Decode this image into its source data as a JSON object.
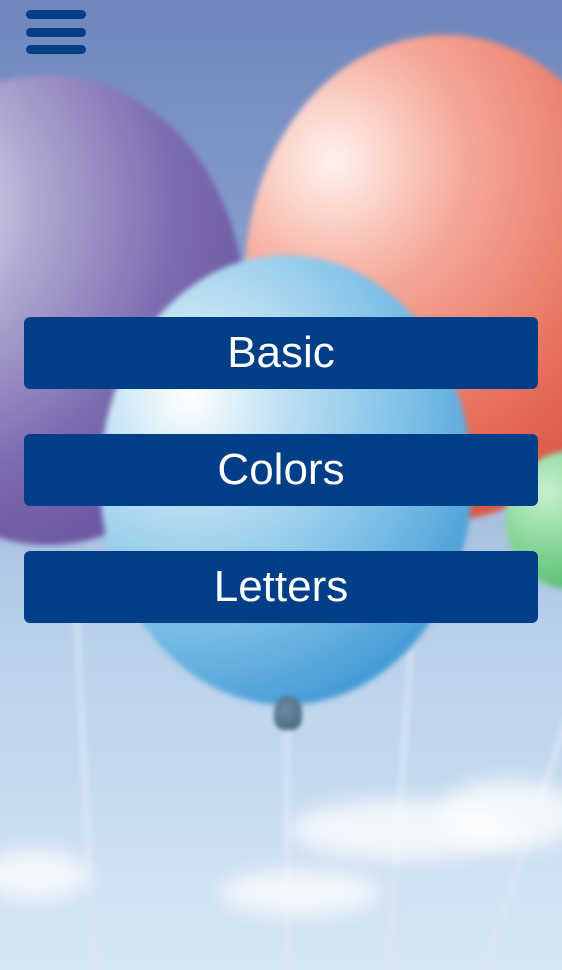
{
  "header": {
    "menu_icon": "hamburger-menu-icon"
  },
  "menu": {
    "items": [
      {
        "label": "Basic"
      },
      {
        "label": "Colors"
      },
      {
        "label": "Letters"
      }
    ]
  },
  "colors": {
    "button_background": "#003f87",
    "button_text": "#ffffff",
    "sky_top": "#6f86bd",
    "sky_bottom": "#d6e7f5"
  }
}
